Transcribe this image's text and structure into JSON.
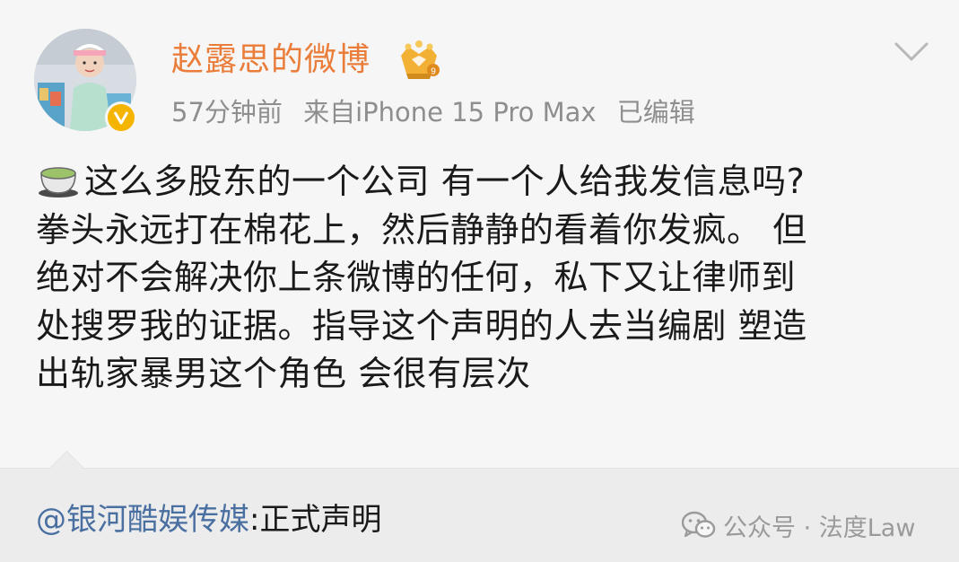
{
  "post": {
    "username": "赵露思的微博",
    "timestamp": "57分钟前",
    "source": "来自iPhone 15 Pro Max",
    "edited_label": "已编辑",
    "body_lines": [
      "这么多股东的一个公司 有一个人给我发信息吗?",
      "拳头永远打在棉花上，然后静静的看着你发疯。 但",
      "绝对不会解决你上条微博的任何，私下又让律师到",
      "处搜罗我的证据。指导这个声明的人去当编剧 塑造",
      "出轨家暴男这个角色 会很有层次"
    ],
    "icons": {
      "avatar": "avatar",
      "verified": "verified-v-icon",
      "crown": "crown-badge-icon",
      "menu": "chevron-down-icon",
      "emoji": "tea-emoji-icon"
    }
  },
  "repost": {
    "mention": "@银河酷娱传媒",
    "separator": ":",
    "title": "正式声明"
  },
  "watermark": {
    "text": "公众号 · 法度Law",
    "icon": "wechat-icon"
  },
  "colors": {
    "username": "#ea7d3a",
    "meta": "#8e8e8e",
    "mention": "#4a6fa1",
    "background": "#f6f6f6",
    "repost_background": "#ececec"
  }
}
